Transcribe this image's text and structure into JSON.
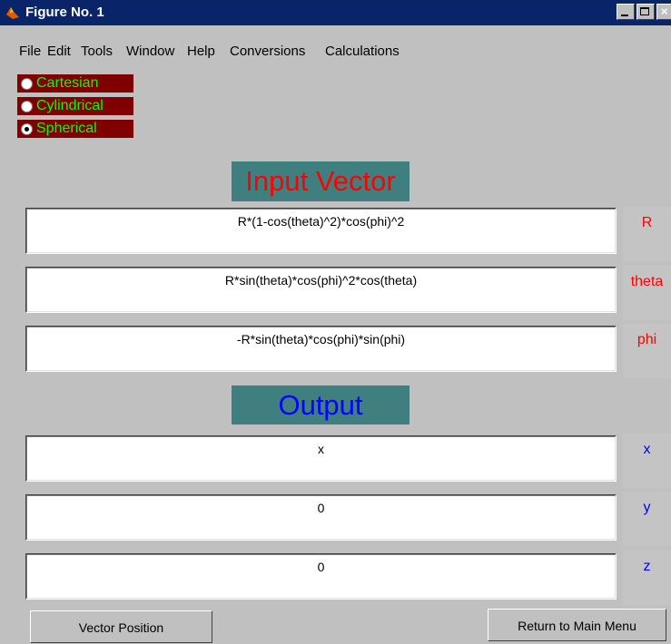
{
  "window": {
    "title": "Figure No. 1"
  },
  "menu": [
    "File",
    "Edit",
    "Tools",
    "Window",
    "Help",
    "Conversions",
    "Calculations"
  ],
  "coordinate_systems": [
    {
      "label": "Cartesian",
      "selected": false
    },
    {
      "label": "Cylindrical",
      "selected": false
    },
    {
      "label": "Spherical",
      "selected": true
    }
  ],
  "input": {
    "heading": "Input Vector",
    "rows": [
      {
        "value": "R*(1-cos(theta)^2)*cos(phi)^2",
        "label": "R"
      },
      {
        "value": "R*sin(theta)*cos(phi)^2*cos(theta)",
        "label": "theta"
      },
      {
        "value": "-R*sin(theta)*cos(phi)*sin(phi)",
        "label": "phi"
      }
    ]
  },
  "output": {
    "heading": "Output",
    "rows": [
      {
        "value": "x",
        "label": "x"
      },
      {
        "value": "0",
        "label": "y"
      },
      {
        "value": "0",
        "label": "z"
      }
    ]
  },
  "buttons": {
    "vector_position": "Vector Position",
    "return_menu": "Return to Main Menu"
  },
  "colors": {
    "title_bar": "#0a246a",
    "heading_bg": "#3f7f7f",
    "input_heading": "#ff0000",
    "output_heading": "#0000ff",
    "radio_bg": "#800000",
    "radio_text": "#00ff00",
    "input_label": "#ff0000",
    "output_label": "#0000ff"
  }
}
